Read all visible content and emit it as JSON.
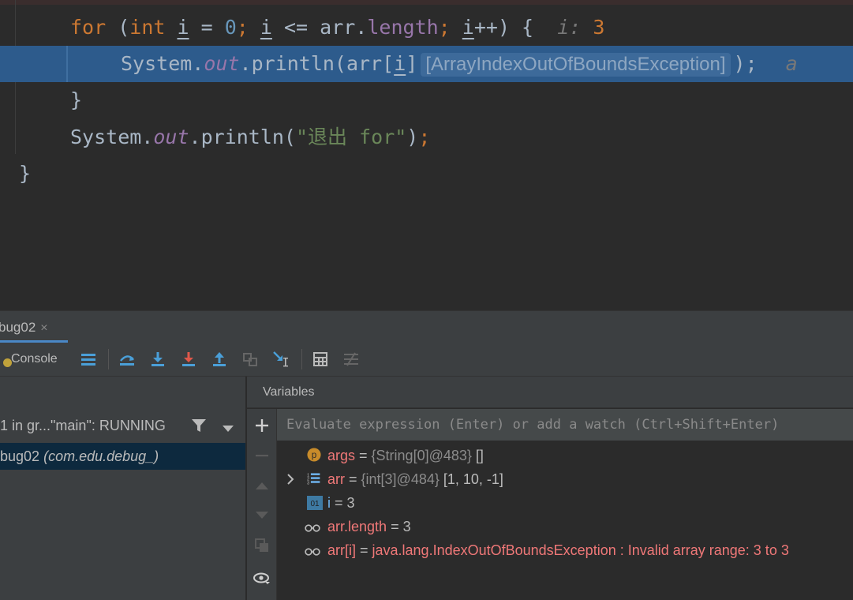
{
  "editor": {
    "for_keyword": "for",
    "for_open": " (",
    "int_kw": "int",
    "loop_var": "i",
    "assign": " = ",
    "zero": "0",
    "semi1": "; ",
    "loop_var2": "i",
    "le": " <= arr.",
    "length_field": "length",
    "semi2": "; ",
    "loop_var3": "i",
    "inc_brace": "++) {",
    "hint_name": "i:",
    "hint_value": "3",
    "sys1": "System.",
    "out1": "out",
    "println_open": ".println(arr[",
    "idx_var": "i",
    "close_bracket": "]",
    "exception_inlay": "[ArrayIndexOutOfBoundsException]",
    "println_close": ");",
    "trailing_hint": "a",
    "close_brace_inner": "}",
    "sys2": "System.",
    "out2": "out",
    "println2_open": ".println(",
    "string_literal": "\"退出 for\"",
    "println2_close": ")",
    "semi3": ";",
    "close_brace_outer": "}"
  },
  "toolwindow": {
    "tab_label": "bug02",
    "tab_close": "×",
    "console_label": "Console"
  },
  "frames": {
    "thread": "1 in gr...\"main\": RUNNING",
    "frame_method": "bug02",
    "frame_class": "(com.edu.debug_)"
  },
  "variables": {
    "title": "Variables",
    "eval_placeholder": "Evaluate expression (Enter) or add a watch (Ctrl+Shift+Enter)",
    "rows": [
      {
        "icon": "parameter-icon",
        "name": "args",
        "eq": " = ",
        "type": "{String[0]@483}",
        "value": " []"
      },
      {
        "icon": "array-icon",
        "name": "arr",
        "eq": " = ",
        "type": "{int[3]@484}",
        "value": " [1, 10, -1]"
      },
      {
        "icon": "primitive-icon",
        "name": "i",
        "eq": " = ",
        "type": "",
        "value": "3"
      },
      {
        "icon": "watch-icon",
        "name": "arr.length",
        "eq": " = ",
        "type": "",
        "value": "3"
      },
      {
        "icon": "watch-icon",
        "name": "arr[i]",
        "eq": " = ",
        "type": "",
        "value": "java.lang.IndexOutOfBoundsException : Invalid array range: 3 to 3"
      }
    ]
  },
  "colors": {
    "editor_bg": "#2b2b2b",
    "exec_line": "#2d5b8c",
    "keyword": "#cc7832",
    "number": "#6897bb",
    "static_field": "#9876aa",
    "string": "#6a8759",
    "var_name": "#f07878"
  }
}
